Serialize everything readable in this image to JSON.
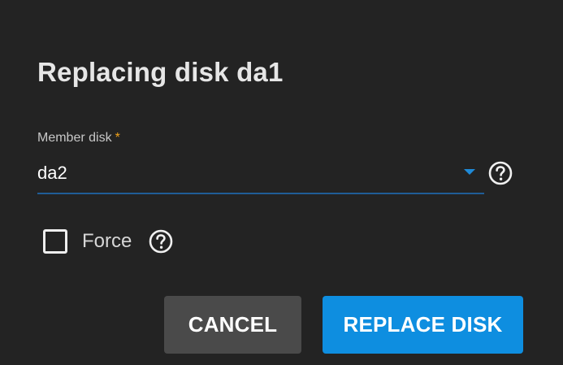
{
  "dialog": {
    "title": "Replacing disk da1",
    "member_disk": {
      "label": "Member disk",
      "required_marker": "*",
      "value": "da2"
    },
    "force": {
      "label": "Force",
      "checked": false
    },
    "buttons": {
      "cancel": "CANCEL",
      "replace": "REPLACE DISK"
    }
  },
  "colors": {
    "background": "#232323",
    "accent": "#0e8ee0",
    "required_star": "#f0a21a",
    "cancel_button": "#4a4a4a"
  },
  "icons": {
    "help": "help-circle-icon",
    "dropdown": "triangle-down-icon"
  }
}
